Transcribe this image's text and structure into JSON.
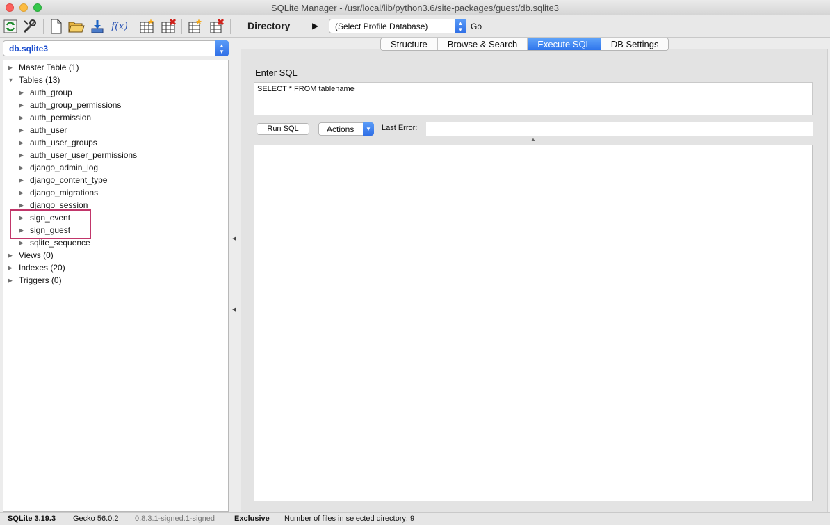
{
  "window": {
    "title": "SQLite Manager - /usr/local/lib/python3.6/site-packages/guest/db.sqlite3"
  },
  "toolbar": {
    "icons": [
      "reconnect-icon",
      "tools-icon",
      "new-database-icon",
      "open-database-icon",
      "import-icon",
      "function-icon",
      "create-table-icon",
      "drop-table-icon",
      "create-index-icon",
      "drop-index-icon"
    ],
    "function_label": "f(x)",
    "directory_label": "Directory",
    "profile_select": "(Select Profile Database)",
    "go_label": "Go"
  },
  "sidebar": {
    "database": "db.sqlite3",
    "tree": [
      {
        "label": "Master Table (1)",
        "expanded": false,
        "level": 0
      },
      {
        "label": "Tables (13)",
        "expanded": true,
        "level": 0
      },
      {
        "label": "auth_group",
        "expanded": false,
        "level": 1
      },
      {
        "label": "auth_group_permissions",
        "expanded": false,
        "level": 1
      },
      {
        "label": "auth_permission",
        "expanded": false,
        "level": 1
      },
      {
        "label": "auth_user",
        "expanded": false,
        "level": 1
      },
      {
        "label": "auth_user_groups",
        "expanded": false,
        "level": 1
      },
      {
        "label": "auth_user_user_permissions",
        "expanded": false,
        "level": 1
      },
      {
        "label": "django_admin_log",
        "expanded": false,
        "level": 1
      },
      {
        "label": "django_content_type",
        "expanded": false,
        "level": 1
      },
      {
        "label": "django_migrations",
        "expanded": false,
        "level": 1
      },
      {
        "label": "django_session",
        "expanded": false,
        "level": 1
      },
      {
        "label": "sign_event",
        "expanded": false,
        "level": 1
      },
      {
        "label": "sign_guest",
        "expanded": false,
        "level": 1
      },
      {
        "label": "sqlite_sequence",
        "expanded": false,
        "level": 1
      },
      {
        "label": "Views (0)",
        "expanded": false,
        "level": 0
      },
      {
        "label": "Indexes (20)",
        "expanded": false,
        "level": 0
      },
      {
        "label": "Triggers (0)",
        "expanded": false,
        "level": 0
      }
    ],
    "highlight_color": "#c1366a"
  },
  "tabs": [
    {
      "label": "Structure",
      "active": false
    },
    {
      "label": "Browse & Search",
      "active": false
    },
    {
      "label": "Execute SQL",
      "active": true
    },
    {
      "label": "DB Settings",
      "active": false
    }
  ],
  "execute_sql": {
    "enter_label": "Enter SQL",
    "query": "SELECT * FROM tablename",
    "run_label": "Run SQL",
    "actions_label": "Actions",
    "last_error_label": "Last Error:",
    "last_error_value": ""
  },
  "statusbar": {
    "sqlite_version": "SQLite 3.19.3",
    "gecko_version": "Gecko 56.0.2",
    "addon_version": "0.8.3.1-signed.1-signed",
    "lock_mode": "Exclusive",
    "files_info": "Number of files in selected directory: 9"
  },
  "colors": {
    "accent": "#2f6ee6",
    "db_name": "#1d4fcf"
  }
}
